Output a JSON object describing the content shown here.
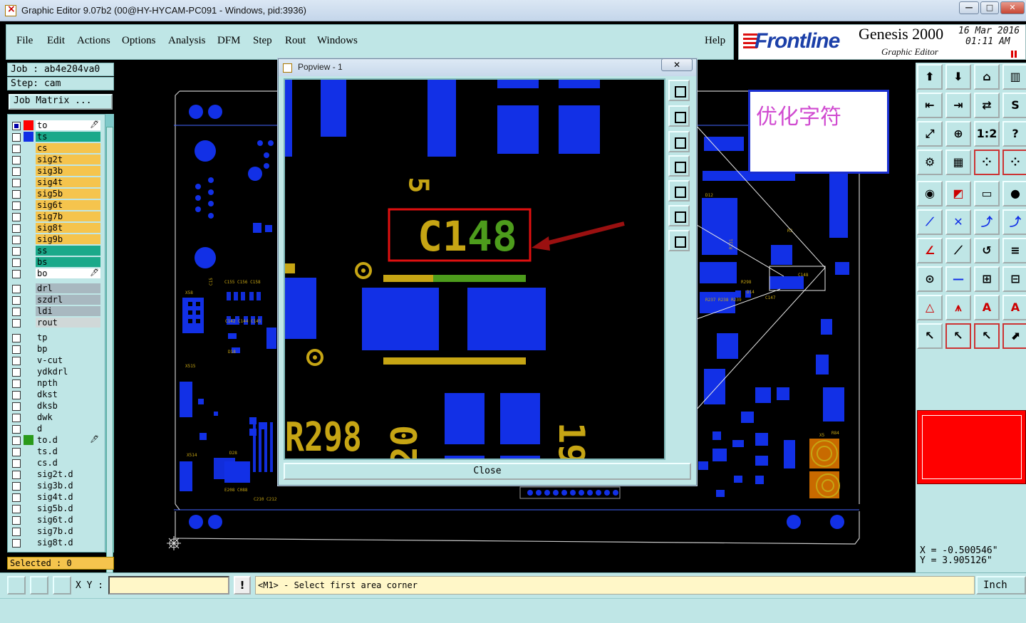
{
  "window": {
    "title": "Graphic Editor 9.07b2 (00@HY-HYCAM-PC091 - Windows, pid:3936)",
    "minimize": "—",
    "maximize": "□",
    "close": "✕"
  },
  "menu": {
    "items": [
      "File",
      "Edit",
      "Actions",
      "Options",
      "Analysis",
      "DFM",
      "Step",
      "Rout",
      "Windows"
    ],
    "help": "Help"
  },
  "brand": {
    "logo": "Frontline",
    "product": "Genesis 2000",
    "subtitle": "Graphic Editor",
    "date": "16 Mar 2016",
    "time": "01:11 AM"
  },
  "job": {
    "job_label": "Job : ab4e204va0",
    "step_label": "Step: cam",
    "matrix_button": "Job Matrix ..."
  },
  "layers": [
    {
      "name": "to",
      "color": "#ffffff",
      "swatch": "#ff0000",
      "checked": true,
      "mark": "🖊"
    },
    {
      "name": "ts",
      "color": "#1aa98a",
      "swatch": "#1230e6",
      "checked": false,
      "mark": ""
    },
    {
      "name": "cs",
      "color": "#f5c44d",
      "swatch": "",
      "checked": false,
      "mark": ""
    },
    {
      "name": "sig2t",
      "color": "#f5c44d",
      "swatch": "",
      "checked": false,
      "mark": ""
    },
    {
      "name": "sig3b",
      "color": "#f5c44d",
      "swatch": "",
      "checked": false,
      "mark": ""
    },
    {
      "name": "sig4t",
      "color": "#f5c44d",
      "swatch": "",
      "checked": false,
      "mark": ""
    },
    {
      "name": "sig5b",
      "color": "#f5c44d",
      "swatch": "",
      "checked": false,
      "mark": ""
    },
    {
      "name": "sig6t",
      "color": "#f5c44d",
      "swatch": "",
      "checked": false,
      "mark": ""
    },
    {
      "name": "sig7b",
      "color": "#f5c44d",
      "swatch": "",
      "checked": false,
      "mark": ""
    },
    {
      "name": "sig8t",
      "color": "#f5c44d",
      "swatch": "",
      "checked": false,
      "mark": ""
    },
    {
      "name": "sig9b",
      "color": "#f5c44d",
      "swatch": "",
      "checked": false,
      "mark": ""
    },
    {
      "name": "ss",
      "color": "#1aa98a",
      "swatch": "",
      "checked": false,
      "mark": ""
    },
    {
      "name": "bs",
      "color": "#1aa98a",
      "swatch": "",
      "checked": false,
      "mark": ""
    },
    {
      "name": "bo",
      "color": "#ffffff",
      "swatch": "",
      "checked": false,
      "mark": "🖊"
    },
    {
      "name": "drl",
      "color": "#a8b8c0",
      "swatch": "",
      "checked": false,
      "mark": "",
      "gap": true
    },
    {
      "name": "szdrl",
      "color": "#a8b8c0",
      "swatch": "",
      "checked": false,
      "mark": ""
    },
    {
      "name": "ldi",
      "color": "#a8b8c0",
      "swatch": "",
      "checked": false,
      "mark": ""
    },
    {
      "name": "rout",
      "color": "#d0d8d8",
      "swatch": "",
      "checked": false,
      "mark": ""
    },
    {
      "name": "tp",
      "color": "#bfe6e6",
      "swatch": "",
      "checked": false,
      "mark": "",
      "gap": true
    },
    {
      "name": "bp",
      "color": "#bfe6e6",
      "swatch": "",
      "checked": false,
      "mark": ""
    },
    {
      "name": "v-cut",
      "color": "#bfe6e6",
      "swatch": "",
      "checked": false,
      "mark": ""
    },
    {
      "name": "ydkdrl",
      "color": "#bfe6e6",
      "swatch": "",
      "checked": false,
      "mark": ""
    },
    {
      "name": "npth",
      "color": "#bfe6e6",
      "swatch": "",
      "checked": false,
      "mark": ""
    },
    {
      "name": "dkst",
      "color": "#bfe6e6",
      "swatch": "",
      "checked": false,
      "mark": ""
    },
    {
      "name": "dksb",
      "color": "#bfe6e6",
      "swatch": "",
      "checked": false,
      "mark": ""
    },
    {
      "name": "dwk",
      "color": "#bfe6e6",
      "swatch": "",
      "checked": false,
      "mark": ""
    },
    {
      "name": "d",
      "color": "#bfe6e6",
      "swatch": "",
      "checked": false,
      "mark": ""
    },
    {
      "name": "to.d",
      "color": "#bfe6e6",
      "swatch": "#2a9a1a",
      "checked": false,
      "mark": "🖊"
    },
    {
      "name": "ts.d",
      "color": "#bfe6e6",
      "swatch": "",
      "checked": false,
      "mark": ""
    },
    {
      "name": "cs.d",
      "color": "#bfe6e6",
      "swatch": "",
      "checked": false,
      "mark": ""
    },
    {
      "name": "sig2t.d",
      "color": "#bfe6e6",
      "swatch": "",
      "checked": false,
      "mark": ""
    },
    {
      "name": "sig3b.d",
      "color": "#bfe6e6",
      "swatch": "",
      "checked": false,
      "mark": ""
    },
    {
      "name": "sig4t.d",
      "color": "#bfe6e6",
      "swatch": "",
      "checked": false,
      "mark": ""
    },
    {
      "name": "sig5b.d",
      "color": "#bfe6e6",
      "swatch": "",
      "checked": false,
      "mark": ""
    },
    {
      "name": "sig6t.d",
      "color": "#bfe6e6",
      "swatch": "",
      "checked": false,
      "mark": ""
    },
    {
      "name": "sig7b.d",
      "color": "#bfe6e6",
      "swatch": "",
      "checked": false,
      "mark": ""
    },
    {
      "name": "sig8t.d",
      "color": "#bfe6e6",
      "swatch": "",
      "checked": false,
      "mark": ""
    }
  ],
  "selected": "Selected : 0",
  "bottom": {
    "xy_label": "X Y :",
    "xy_value": "",
    "warn": "!",
    "prompt": "<M1> - Select first area corner",
    "unit": "Inch"
  },
  "coords": {
    "x": "X = -0.500546\"",
    "y": "Y = 3.905126\""
  },
  "popview": {
    "title": "Popview - 1",
    "close_x": "✕",
    "close_button": "Close",
    "labels": {
      "five": "5",
      "c148_c": "C1",
      "c148_48": "48",
      "r298": "R298",
      "twenty": "20",
      "nineteen": "19"
    }
  },
  "annotation": "优化字符",
  "right_tools": [
    [
      "⬆",
      "⬇",
      "⌂",
      "▥"
    ],
    [
      "⇤",
      "⇥",
      "⇄",
      "S"
    ],
    [
      "⤢",
      "⊕",
      "1:2",
      "?"
    ],
    [
      "⚙",
      "▦",
      "⁘",
      "⁘"
    ],
    [
      "◉",
      "◩",
      "▭",
      "●"
    ],
    [
      "⟋",
      "✕",
      "⤴",
      "⤴"
    ],
    [
      "∠",
      "⟋",
      "↺",
      "≡"
    ],
    [
      "⊙",
      "—",
      "⊞",
      "⊟"
    ],
    [
      "△",
      "⩚",
      "A",
      "A"
    ],
    [
      "↖",
      "↖",
      "↖",
      "⬈"
    ]
  ]
}
